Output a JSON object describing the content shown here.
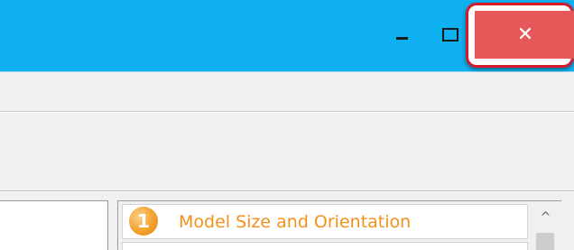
{
  "window": {
    "minimize_icon": "minimize-icon",
    "maximize_icon": "maximize-icon",
    "close_glyph": "✕",
    "close_icon": "close-icon",
    "titlebar_color": "#0eb0f0",
    "close_color": "#e55758",
    "highlight_ring_color": "#d7192b"
  },
  "steps_panel": {
    "items": [
      {
        "number": "1",
        "label": "Model Size and Orientation",
        "label_color": "#f3901a"
      }
    ],
    "scroll_up_glyph": "^"
  }
}
